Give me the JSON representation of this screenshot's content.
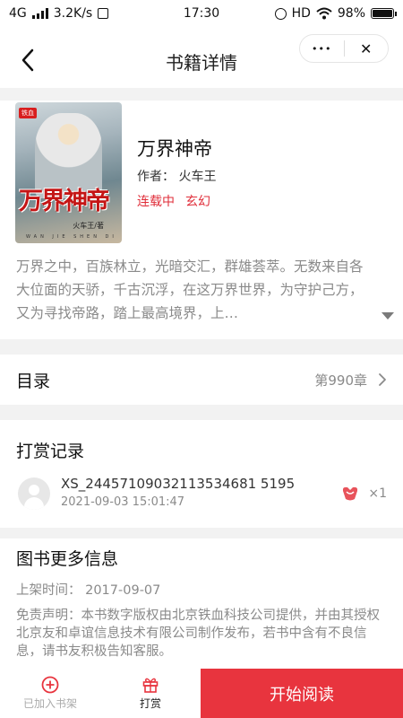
{
  "status_bar": {
    "network": "4G",
    "speed": "3.2K/s",
    "time": "17:30",
    "hd": "HD",
    "battery": "98%",
    "battery_level": 0.98
  },
  "nav": {
    "title": "书籍详情",
    "more_glyph": "•••",
    "close_glyph": "✕"
  },
  "book": {
    "cover_badge": "铁血",
    "cover_title": "万界神帝",
    "cover_author": "火车王/著",
    "cover_pinyin": "WAN JIE SHEN DI",
    "title": "万界神帝",
    "author": "作者：  火车王",
    "status": "连载中",
    "genre": "玄幻",
    "synopsis": "万界之中，百族林立，光暗交汇，群雄荟萃。无数来自各大位面的天骄，千古沉浮，在这万界世界，为守护己方，又为寻找帝路，踏上最高境界，上…"
  },
  "toc": {
    "label": "目录",
    "latest_chapter": "第990章"
  },
  "tips": {
    "title": "打赏记录",
    "records": [
      {
        "user": "XS_24457109032113534681 5195",
        "time": "2021-09-03 15:01:47",
        "count": "×1"
      }
    ]
  },
  "more_info": {
    "title": "图书更多信息",
    "shelf_date": "上架时间：  2017-09-07",
    "disclaimer": "免责声明：本书数字版权由北京铁血科技公司提供，并由其授权北京友和卓谊信息技术有限公司制作发布，若书中含有不良信息，请书友积极告知客服。"
  },
  "bottom_bar": {
    "add_shelf": "已加入书架",
    "reward": "打赏",
    "start_reading": "开始阅读"
  },
  "colors": {
    "accent": "#e8343e",
    "muted": "#8a8a8a",
    "background": "#f2f2f2"
  },
  "icons": {
    "back": "chevron-left-icon",
    "more": "more-dots-icon",
    "close": "close-icon",
    "chevron": "chevron-right-icon",
    "expand": "caret-down-icon",
    "gift": "gift-icon",
    "add": "plus-circle-icon",
    "avatar": "avatar-placeholder-icon"
  }
}
